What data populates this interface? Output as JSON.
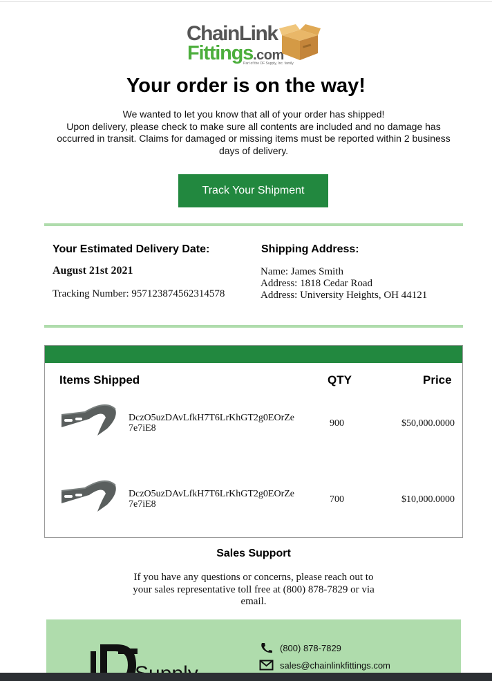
{
  "brand": {
    "logo_line1": "ChainLink",
    "logo_line2": "Fittings",
    "logo_suffix": ".com",
    "logo_tagline": "Part of the DF Supply, Inc. family"
  },
  "colors": {
    "brand_green": "#22883f",
    "rule_green": "#afdcac",
    "footer_bg": "#afdcac",
    "logo_green": "#4cae3c"
  },
  "header": {
    "headline": "Your order is on the way!",
    "intro_line1": "We wanted to let you know that all of your order has shipped!",
    "intro_line2": "Upon delivery, please check to make sure all contents are included and no damage has occurred in transit. Claims for damaged or missing items must be reported within 2 business days of delivery.",
    "track_button": "Track Your Shipment"
  },
  "delivery": {
    "label": "Your Estimated Delivery Date:",
    "date": "August 21st 2021",
    "tracking_text": "Tracking Number: 957123874562314578"
  },
  "shipping": {
    "label": "Shipping Address:",
    "name_line": "Name: James Smith",
    "address_line1": "Address: 1818 Cedar Road",
    "address_line2": "Address: University Heights, OH 44121"
  },
  "items": {
    "col_items": "Items Shipped",
    "col_qty": "QTY",
    "col_price": "Price",
    "rows": [
      {
        "name": "DczO5uzDAvLfkH7T6LrKhGT2g0EOrZe7e7iE8",
        "qty": "900",
        "price": "$50,000.0000",
        "icon": "fence-band-icon"
      },
      {
        "name": "DczO5uzDAvLfkH7T6LrKhGT2g0EOrZe7e7iE8",
        "qty": "700",
        "price": "$10,000.0000",
        "icon": "fence-band-icon"
      }
    ]
  },
  "support": {
    "title": "Sales Support",
    "text": "If you have any questions or concerns, please reach out to your sales representative toll free at (800) 878-7829 or via email."
  },
  "footer": {
    "df_logo_text": "Supply",
    "phone": "(800) 878-7829",
    "email": "sales@chainlinkfittings.com",
    "phone_icon": "phone-icon",
    "email_icon": "envelope-icon"
  }
}
